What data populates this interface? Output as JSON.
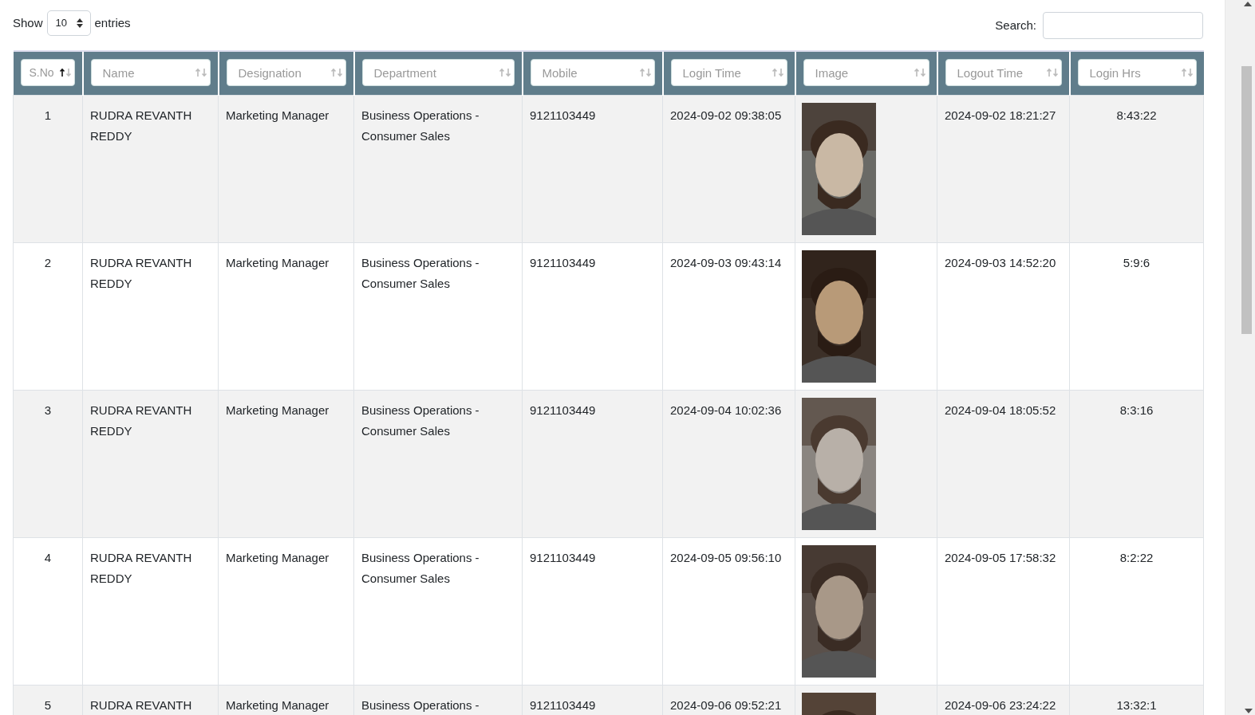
{
  "length": {
    "label_before": "Show",
    "value": "10",
    "label_after": "entries"
  },
  "search": {
    "label": "Search:"
  },
  "columns": [
    {
      "placeholder": "S.No",
      "sorted": true
    },
    {
      "placeholder": "Name",
      "sorted": false
    },
    {
      "placeholder": "Designation",
      "sorted": false
    },
    {
      "placeholder": "Department",
      "sorted": false
    },
    {
      "placeholder": "Mobile",
      "sorted": false
    },
    {
      "placeholder": "Login Time",
      "sorted": false
    },
    {
      "placeholder": "Image",
      "sorted": false
    },
    {
      "placeholder": "Logout Time",
      "sorted": false
    },
    {
      "placeholder": "Login Hrs",
      "sorted": false
    }
  ],
  "rows": [
    {
      "sno": "1",
      "name": "RUDRA REVANTH REDDY",
      "designation": "Marketing Manager",
      "department": "Business Operations - Consumer Sales",
      "mobile": "9121103449",
      "login_time": "2024-09-02 09:38:05",
      "logout_time": "2024-09-02 18:21:27",
      "login_hrs": "8:43:22"
    },
    {
      "sno": "2",
      "name": "RUDRA REVANTH REDDY",
      "designation": "Marketing Manager",
      "department": "Business Operations - Consumer Sales",
      "mobile": "9121103449",
      "login_time": "2024-09-03 09:43:14",
      "logout_time": "2024-09-03 14:52:20",
      "login_hrs": "5:9:6"
    },
    {
      "sno": "3",
      "name": "RUDRA REVANTH REDDY",
      "designation": "Marketing Manager",
      "department": "Business Operations - Consumer Sales",
      "mobile": "9121103449",
      "login_time": "2024-09-04 10:02:36",
      "logout_time": "2024-09-04 18:05:52",
      "login_hrs": "8:3:16"
    },
    {
      "sno": "4",
      "name": "RUDRA REVANTH REDDY",
      "designation": "Marketing Manager",
      "department": "Business Operations - Consumer Sales",
      "mobile": "9121103449",
      "login_time": "2024-09-05 09:56:10",
      "logout_time": "2024-09-05 17:58:32",
      "login_hrs": "8:2:22"
    },
    {
      "sno": "5",
      "name": "RUDRA REVANTH",
      "designation": "Marketing Manager",
      "department": "Business Operations -",
      "mobile": "9121103449",
      "login_time": "2024-09-06 09:52:21",
      "logout_time": "2024-09-06 23:24:22",
      "login_hrs": "13:32:1"
    }
  ]
}
